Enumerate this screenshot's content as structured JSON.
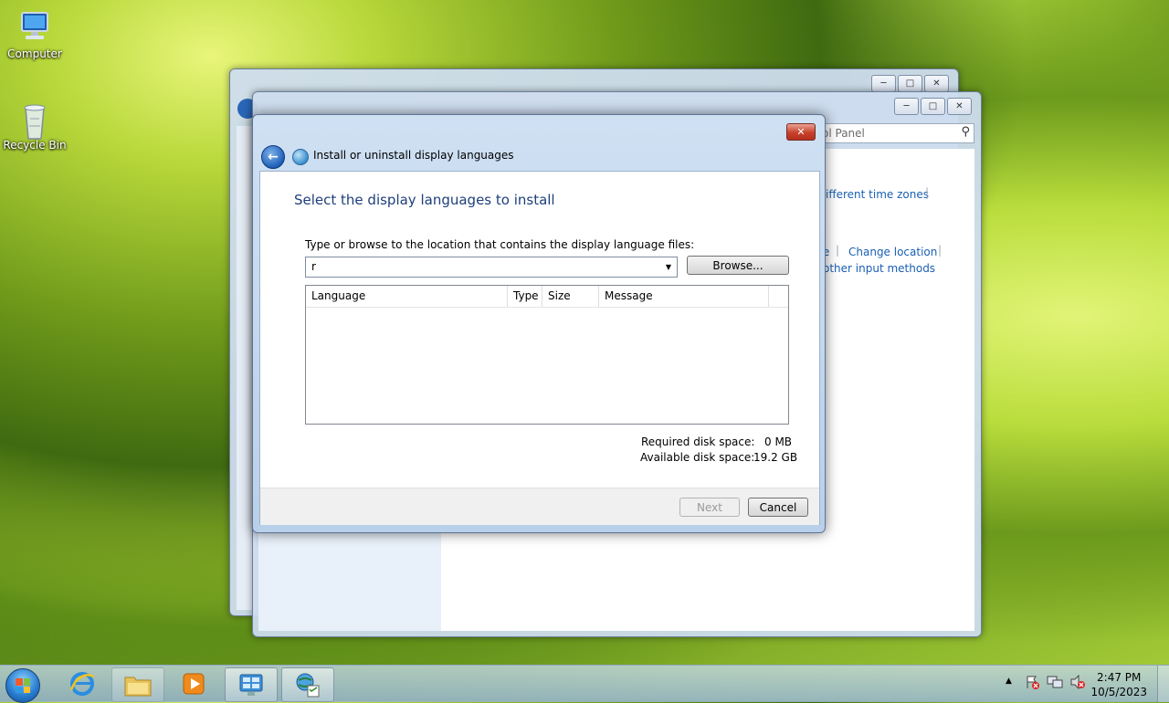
{
  "desktop": {
    "icons": [
      {
        "label": "Computer"
      },
      {
        "label": "Recycle Bin"
      }
    ]
  },
  "background_window": {
    "search_placeholder": "ol Panel",
    "links": {
      "time_zones": "ifferent time zones",
      "e_fragment": "e",
      "change_location": "Change location",
      "input_methods": "other input methods"
    }
  },
  "dialog": {
    "caption": "Install or uninstall display languages",
    "heading": "Select the display languages to install",
    "prompt": "Type or browse to the location that contains the display language files:",
    "path_value": "r",
    "browse_label": "Browse...",
    "columns": [
      "Language",
      "Type",
      "Size",
      "Message"
    ],
    "disk": {
      "required_label": "Required disk space:",
      "required_value": "0 MB",
      "available_label": "Available disk space:",
      "available_value": "19.2 GB"
    },
    "next_label": "Next",
    "cancel_label": "Cancel"
  },
  "taskbar": {
    "time": "2:47 PM",
    "date": "10/5/2023",
    "items": [
      "internet-explorer",
      "file-explorer",
      "media-player",
      "control-panel",
      "language-installer"
    ]
  },
  "colors": {
    "heading_blue": "#1e3f7a",
    "link_blue": "#1a5fb4"
  }
}
